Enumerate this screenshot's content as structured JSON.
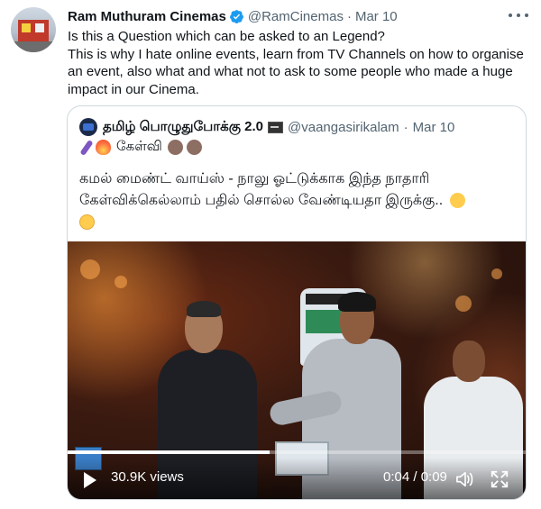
{
  "tweet": {
    "author_name": "Ram Muthuram Cinemas",
    "handle": "@RamCinemas",
    "separator": "·",
    "date": "Mar 10",
    "text": "Is this a Question which can be asked to an Legend?\nThis is why I hate online events, learn from TV Channels on how to organise an event, also what and what not to ask to some people who made a huge impact in our Cinema."
  },
  "quote": {
    "author_name": "தமிழ் பொழுதுபோக்கு 2.0",
    "handle": "@vaangasirikalam",
    "separator": "·",
    "date": "Mar 10",
    "line2": "கேள்வி",
    "text": "கமல் மைண்ட் வாய்ஸ் - நாலு ஓட்டுக்காக இந்த நாதாரி கேள்விக்கெல்லாம் பதில் சொல்ல வேண்டியதா இருக்கு..",
    "video": {
      "views": "30.9K views",
      "time": "0:04 / 0:09",
      "progress": 0.44
    }
  },
  "icons": {
    "verified": "verified-badge-icon",
    "more": "more-options-icon",
    "play": "play-icon",
    "volume": "volume-icon",
    "fullscreen": "fullscreen-icon"
  },
  "colors": {
    "verified": "#1d9bf0",
    "secondary_text": "#536471",
    "border": "#cfd9de"
  }
}
